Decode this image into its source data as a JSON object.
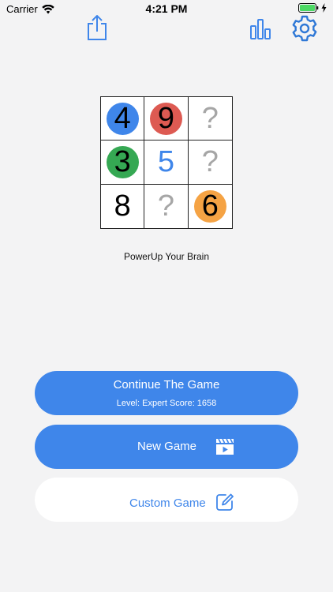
{
  "status_bar": {
    "carrier": "Carrier",
    "time": "4:21 PM",
    "icons": [
      "wifi-icon",
      "battery-icon",
      "charging-bolt-icon"
    ]
  },
  "nav": {
    "left_icon": "share-icon",
    "right_icons": [
      "stats-chart-icon",
      "gear-icon"
    ]
  },
  "colors": {
    "accent": "#3f86ea",
    "background": "#f3f3f4",
    "disc_blue": "#3f86ea",
    "disc_red": "#dd5a52",
    "disc_green": "#35a853",
    "disc_orange": "#f5a344",
    "question_gray": "#a6a6a6"
  },
  "grid": {
    "cells": [
      {
        "value": "4",
        "style": "disc",
        "color": "#3f86ea"
      },
      {
        "value": "9",
        "style": "disc",
        "color": "#dd5a52"
      },
      {
        "value": "?",
        "style": "question",
        "color": "#a6a6a6"
      },
      {
        "value": "3",
        "style": "disc",
        "color": "#35a853"
      },
      {
        "value": "5",
        "style": "plain",
        "color": "#3f86ea"
      },
      {
        "value": "?",
        "style": "question",
        "color": "#a6a6a6"
      },
      {
        "value": "8",
        "style": "plain",
        "color": "#000000"
      },
      {
        "value": "?",
        "style": "question",
        "color": "#a6a6a6"
      },
      {
        "value": "6",
        "style": "disc",
        "color": "#f5a344"
      }
    ]
  },
  "tagline": "PowerUp Your Brain",
  "buttons": {
    "continue": {
      "title": "Continue The Game",
      "subtitle": "Level: Expert Score: 1658"
    },
    "new_game": {
      "label": "New Game",
      "icon": "clapperboard-play-icon"
    },
    "custom_game": {
      "label": "Custom Game",
      "icon": "edit-pencil-icon"
    }
  }
}
